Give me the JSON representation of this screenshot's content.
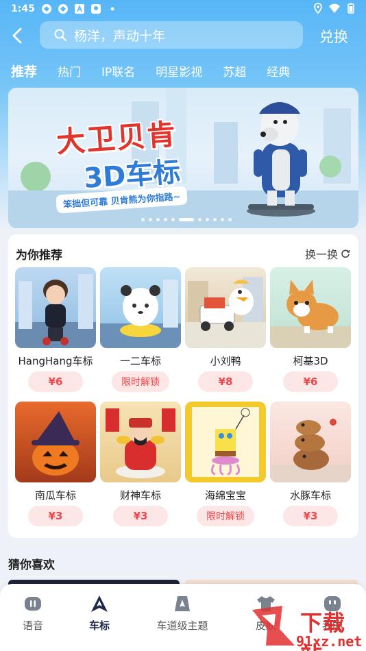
{
  "status_bar": {
    "time": "1:45"
  },
  "header": {
    "search_text": "杨洋，声动十年",
    "redeem_label": "兑换"
  },
  "tabs": [
    {
      "label": "推荐",
      "active": true
    },
    {
      "label": "热门",
      "active": false
    },
    {
      "label": "IP联名",
      "active": false
    },
    {
      "label": "明星影视",
      "active": false
    },
    {
      "label": "苏超",
      "active": false
    },
    {
      "label": "经典",
      "active": false
    }
  ],
  "banner": {
    "title": "大卫贝肯",
    "subtitle": "3D车标",
    "slogan": "笨拙但可靠 贝肯熊为你指路~",
    "slides": 11,
    "active_slide": 5
  },
  "recommend": {
    "title": "为你推荐",
    "shuffle_label": "换一换",
    "items": [
      {
        "name": "HangHang车标",
        "price": "¥6",
        "locked": false
      },
      {
        "name": "一二车标",
        "price": "限时解锁",
        "locked": true
      },
      {
        "name": "小刘鸭",
        "price": "¥8",
        "locked": false
      },
      {
        "name": "柯基3D",
        "price": "¥6",
        "locked": false
      },
      {
        "name": "南瓜车标",
        "price": "¥3",
        "locked": false
      },
      {
        "name": "财神车标",
        "price": "¥3",
        "locked": false
      },
      {
        "name": "海绵宝宝",
        "price": "限时解锁",
        "locked": true
      },
      {
        "name": "水豚车标",
        "price": "¥3",
        "locked": false
      }
    ]
  },
  "guess": {
    "title": "猜你喜欢"
  },
  "bottom_nav": [
    {
      "label": "语音",
      "icon": "voice-icon",
      "active": false
    },
    {
      "label": "车标",
      "icon": "car-logo-icon",
      "active": true
    },
    {
      "label": "车道级主题",
      "icon": "lane-theme-icon",
      "active": false
    },
    {
      "label": "皮肤",
      "icon": "skin-icon",
      "active": false
    },
    {
      "label": "我的",
      "icon": "profile-icon",
      "active": false
    }
  ],
  "watermark": {
    "line1": "下载站",
    "line2": "91xz.net"
  },
  "colors": {
    "accent": "#57b6f7",
    "price_red": "#f0464a",
    "price_bg": "#fde6e6",
    "nav_active": "#1e2a4a"
  }
}
